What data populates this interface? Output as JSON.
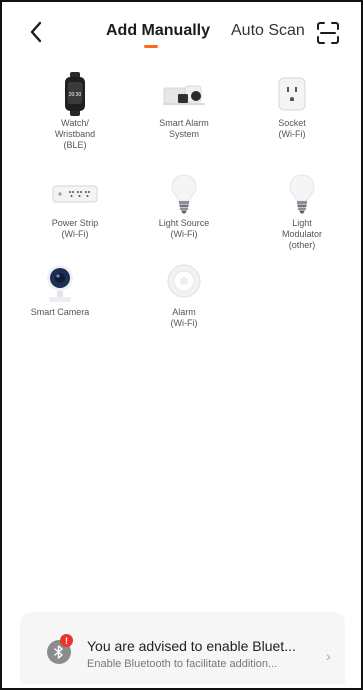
{
  "header": {
    "back_icon": "chevron-left-icon",
    "tabs": [
      {
        "label": "Add Manually",
        "active": true
      },
      {
        "label": "Auto Scan",
        "active": false
      }
    ],
    "scan_icon": "scan-frame-icon",
    "accent_color": "#ff6a1a"
  },
  "devices": [
    {
      "label": "Watch/ Wristband (BLE)",
      "icon": "smartwatch-icon",
      "watch_time": "20:30"
    },
    {
      "label": "Smart Alarm System",
      "icon": "alarm-system-icon"
    },
    {
      "label": "Socket (Wi-Fi)",
      "icon": "socket-icon"
    },
    {
      "label": "Power Strip (Wi-Fi)",
      "icon": "power-strip-icon"
    },
    {
      "label": "Light Source (Wi-Fi)",
      "icon": "light-bulb-icon"
    },
    {
      "label": "Light Modulator (other)",
      "icon": "light-bulb-icon"
    },
    {
      "label": "Smart Camera",
      "icon": "camera-icon"
    },
    {
      "label": "Alarm (Wi-Fi)",
      "icon": "alarm-sensor-icon"
    }
  ],
  "banner": {
    "title": "You are advised to enable Bluet...",
    "subtitle": "Enable Bluetooth to facilitate addition...",
    "badge": "!",
    "icon": "bluetooth-icon",
    "chevron": "›"
  }
}
